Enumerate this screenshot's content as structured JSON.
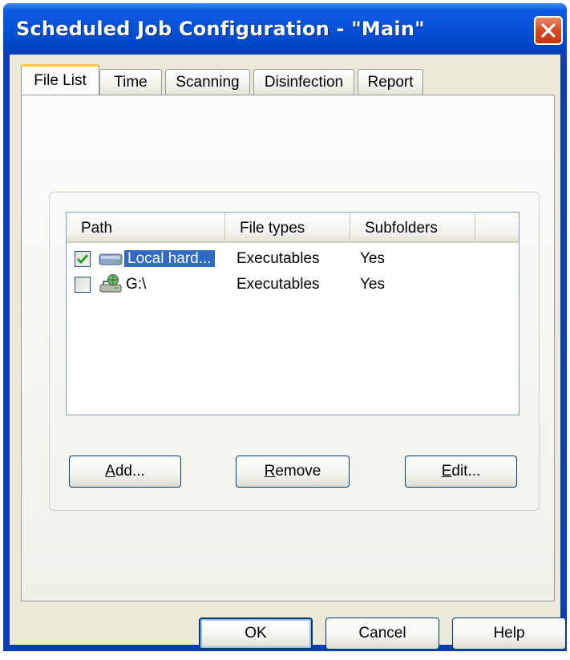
{
  "window": {
    "title": "Scheduled Job Configuration - \"Main\""
  },
  "tabs": [
    {
      "label": "File List",
      "active": true
    },
    {
      "label": "Time",
      "active": false
    },
    {
      "label": "Scanning",
      "active": false
    },
    {
      "label": "Disinfection",
      "active": false
    },
    {
      "label": "Report",
      "active": false
    }
  ],
  "file_list": {
    "columns": [
      "Path",
      "File types",
      "Subfolders"
    ],
    "rows": [
      {
        "checked": true,
        "selected": true,
        "icon": "hard-drive-icon",
        "path": "Local hard...",
        "file_types": "Executables",
        "subfolders": "Yes"
      },
      {
        "checked": false,
        "selected": false,
        "icon": "network-drive-icon",
        "path": "G:\\",
        "file_types": "Executables",
        "subfolders": "Yes"
      }
    ]
  },
  "list_buttons": {
    "add": {
      "mnemonic": "A",
      "rest": "dd..."
    },
    "remove": {
      "mnemonic": "R",
      "rest": "emove"
    },
    "edit": {
      "mnemonic": "E",
      "rest": "dit..."
    }
  },
  "dialog_buttons": {
    "ok": "OK",
    "cancel": "Cancel",
    "help": "Help"
  },
  "colors": {
    "title_bar": "#0652d8",
    "selection": "#316ac5",
    "active_tab_accent": "#ffc83c",
    "close_button": "#d64a22"
  }
}
